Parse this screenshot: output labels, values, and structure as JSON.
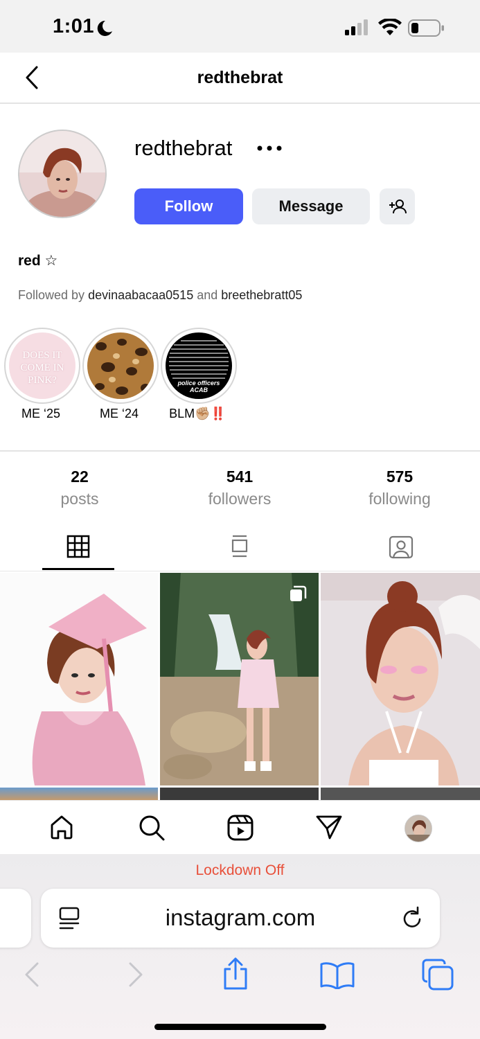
{
  "status_bar": {
    "time": "1:01"
  },
  "header": {
    "title": "redthebrat"
  },
  "profile": {
    "username": "redthebrat",
    "follow_label": "Follow",
    "message_label": "Message",
    "display_name": "red ☆",
    "followed_by_prefix": "Followed by ",
    "followed_by_user1": "devinaabacaa0515",
    "followed_by_and": " and ",
    "followed_by_user2": "breethebratt05"
  },
  "highlights": [
    {
      "label": "ME ‘25",
      "cover_text": "DOES IT COME IN PINK?"
    },
    {
      "label": "ME ‘24"
    },
    {
      "label": "BLM✊🏼‼️",
      "cover_text_bottom": "police officers ACAB"
    }
  ],
  "stats": [
    {
      "value": "22",
      "label": "posts"
    },
    {
      "value": "541",
      "label": "followers"
    },
    {
      "value": "575",
      "label": "following"
    }
  ],
  "tabs": [
    "grid-icon",
    "feed-icon",
    "tagged-icon"
  ],
  "bottom_nav": [
    "home-icon",
    "search-icon",
    "reels-icon",
    "direct-icon",
    "profile-avatar"
  ],
  "safari": {
    "lockdown": "Lockdown Off",
    "url": "instagram.com"
  },
  "colors": {
    "follow_button": "#4a5df9",
    "lockdown": "#e8503a",
    "safari_icons": "#2f7cf6"
  }
}
